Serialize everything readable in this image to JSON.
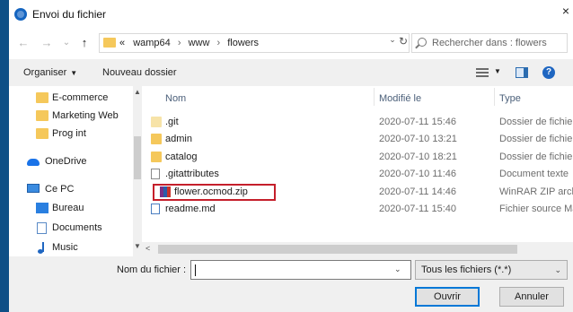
{
  "window": {
    "title": "Envoi du fichier",
    "close_glyph": "×",
    "icon": "app-globe-icon"
  },
  "nav": {
    "back_glyph": "←",
    "forward_glyph": "→",
    "dropdown_glyph": "⌄",
    "up_glyph": "↑",
    "address": {
      "prefix": "«",
      "path": [
        "wamp64",
        "www",
        "flowers"
      ],
      "separator": "›",
      "dropdown_glyph": "⌄",
      "refresh_glyph": "↻"
    },
    "search_placeholder": "Rechercher dans : flowers"
  },
  "toolbar": {
    "organize_label": "Organiser",
    "organize_caret": "▼",
    "new_folder_label": "Nouveau dossier",
    "view_caret": "▼",
    "help_glyph": "?"
  },
  "sidebar": {
    "scroll_up": "▲",
    "scroll_down": "▼",
    "items": [
      {
        "label": "E-commerce",
        "icon": "folder-icon"
      },
      {
        "label": "Marketing Web",
        "icon": "folder-icon"
      },
      {
        "label": "Prog int",
        "icon": "folder-icon"
      },
      {
        "label": "OneDrive",
        "icon": "onedrive-icon"
      },
      {
        "label": "Ce PC",
        "icon": "pc-icon"
      },
      {
        "label": "Bureau",
        "icon": "desktop-icon"
      },
      {
        "label": "Documents",
        "icon": "documents-icon"
      },
      {
        "label": "Music",
        "icon": "music-icon"
      }
    ]
  },
  "filelist": {
    "sort_glyph": "^",
    "columns": {
      "name": "Nom",
      "modified": "Modifié le",
      "type": "Type"
    },
    "rows": [
      {
        "name": ".git",
        "modified": "2020-07-11 15:46",
        "type": "Dossier de fichiers",
        "icon": "folder-icon"
      },
      {
        "name": "admin",
        "modified": "2020-07-10 13:21",
        "type": "Dossier de fichiers",
        "icon": "folder-icon"
      },
      {
        "name": "catalog",
        "modified": "2020-07-10 18:21",
        "type": "Dossier de fichiers",
        "icon": "folder-icon"
      },
      {
        "name": ".gitattributes",
        "modified": "2020-07-10 11:46",
        "type": "Document texte",
        "icon": "text-file-icon"
      },
      {
        "name": "flower.ocmod.zip",
        "modified": "2020-07-11 14:46",
        "type": "WinRAR ZIP archive",
        "icon": "winrar-zip-icon"
      },
      {
        "name": "readme.md",
        "modified": "2020-07-11 15:40",
        "type": "Fichier source Mar...",
        "icon": "markdown-file-icon"
      }
    ],
    "hscroll_left": "<"
  },
  "footer": {
    "filename_label": "Nom du fichier :",
    "filename_value": "",
    "filename_dropdown": "⌄",
    "filter_value": "Tous les fichiers (*.*)",
    "filter_dropdown": "⌄",
    "open_label": "Ouvrir",
    "cancel_label": "Annuler"
  },
  "colors": {
    "accent": "#0078d7",
    "highlight_box": "#c51f2b",
    "folder": "#f5c85b",
    "frame": "#0e4f86"
  }
}
